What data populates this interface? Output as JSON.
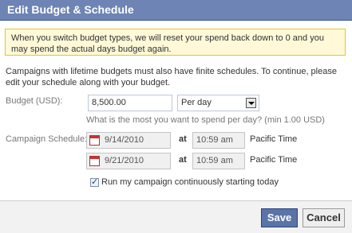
{
  "dialog": {
    "title": "Edit Budget & Schedule",
    "warning": "When you switch budget types, we will reset your spend back down to 0 and you may spend the actual days budget again.",
    "notice": "Campaigns with lifetime budgets must also have finite schedules. To continue, please edit your schedule along with your budget."
  },
  "budget": {
    "label": "Budget (USD):",
    "amount": "8,500.00",
    "type_selected": "Per day",
    "hint": "What is the most you want to spend per day? (min 1.00 USD)"
  },
  "schedule": {
    "label": "Campaign Schedule:",
    "at_label": "at",
    "start": {
      "date": "9/14/2010",
      "time": "10:59 am",
      "timezone": "Pacific Time"
    },
    "end": {
      "date": "9/21/2010",
      "time": "10:59 am",
      "timezone": "Pacific Time"
    },
    "continuous_label": "Run my campaign continuously starting today",
    "continuous_checked": true
  },
  "footer": {
    "save_label": "Save",
    "cancel_label": "Cancel"
  },
  "icons": [
    "calendar-icon",
    "dropdown-arrow-icon",
    "checkbox-checked-icon"
  ],
  "colors": {
    "title_bar": "#6d84b4",
    "warning_bg": "#fff9d7",
    "warning_border": "#e2c822",
    "save_button": "#5b74a8"
  }
}
